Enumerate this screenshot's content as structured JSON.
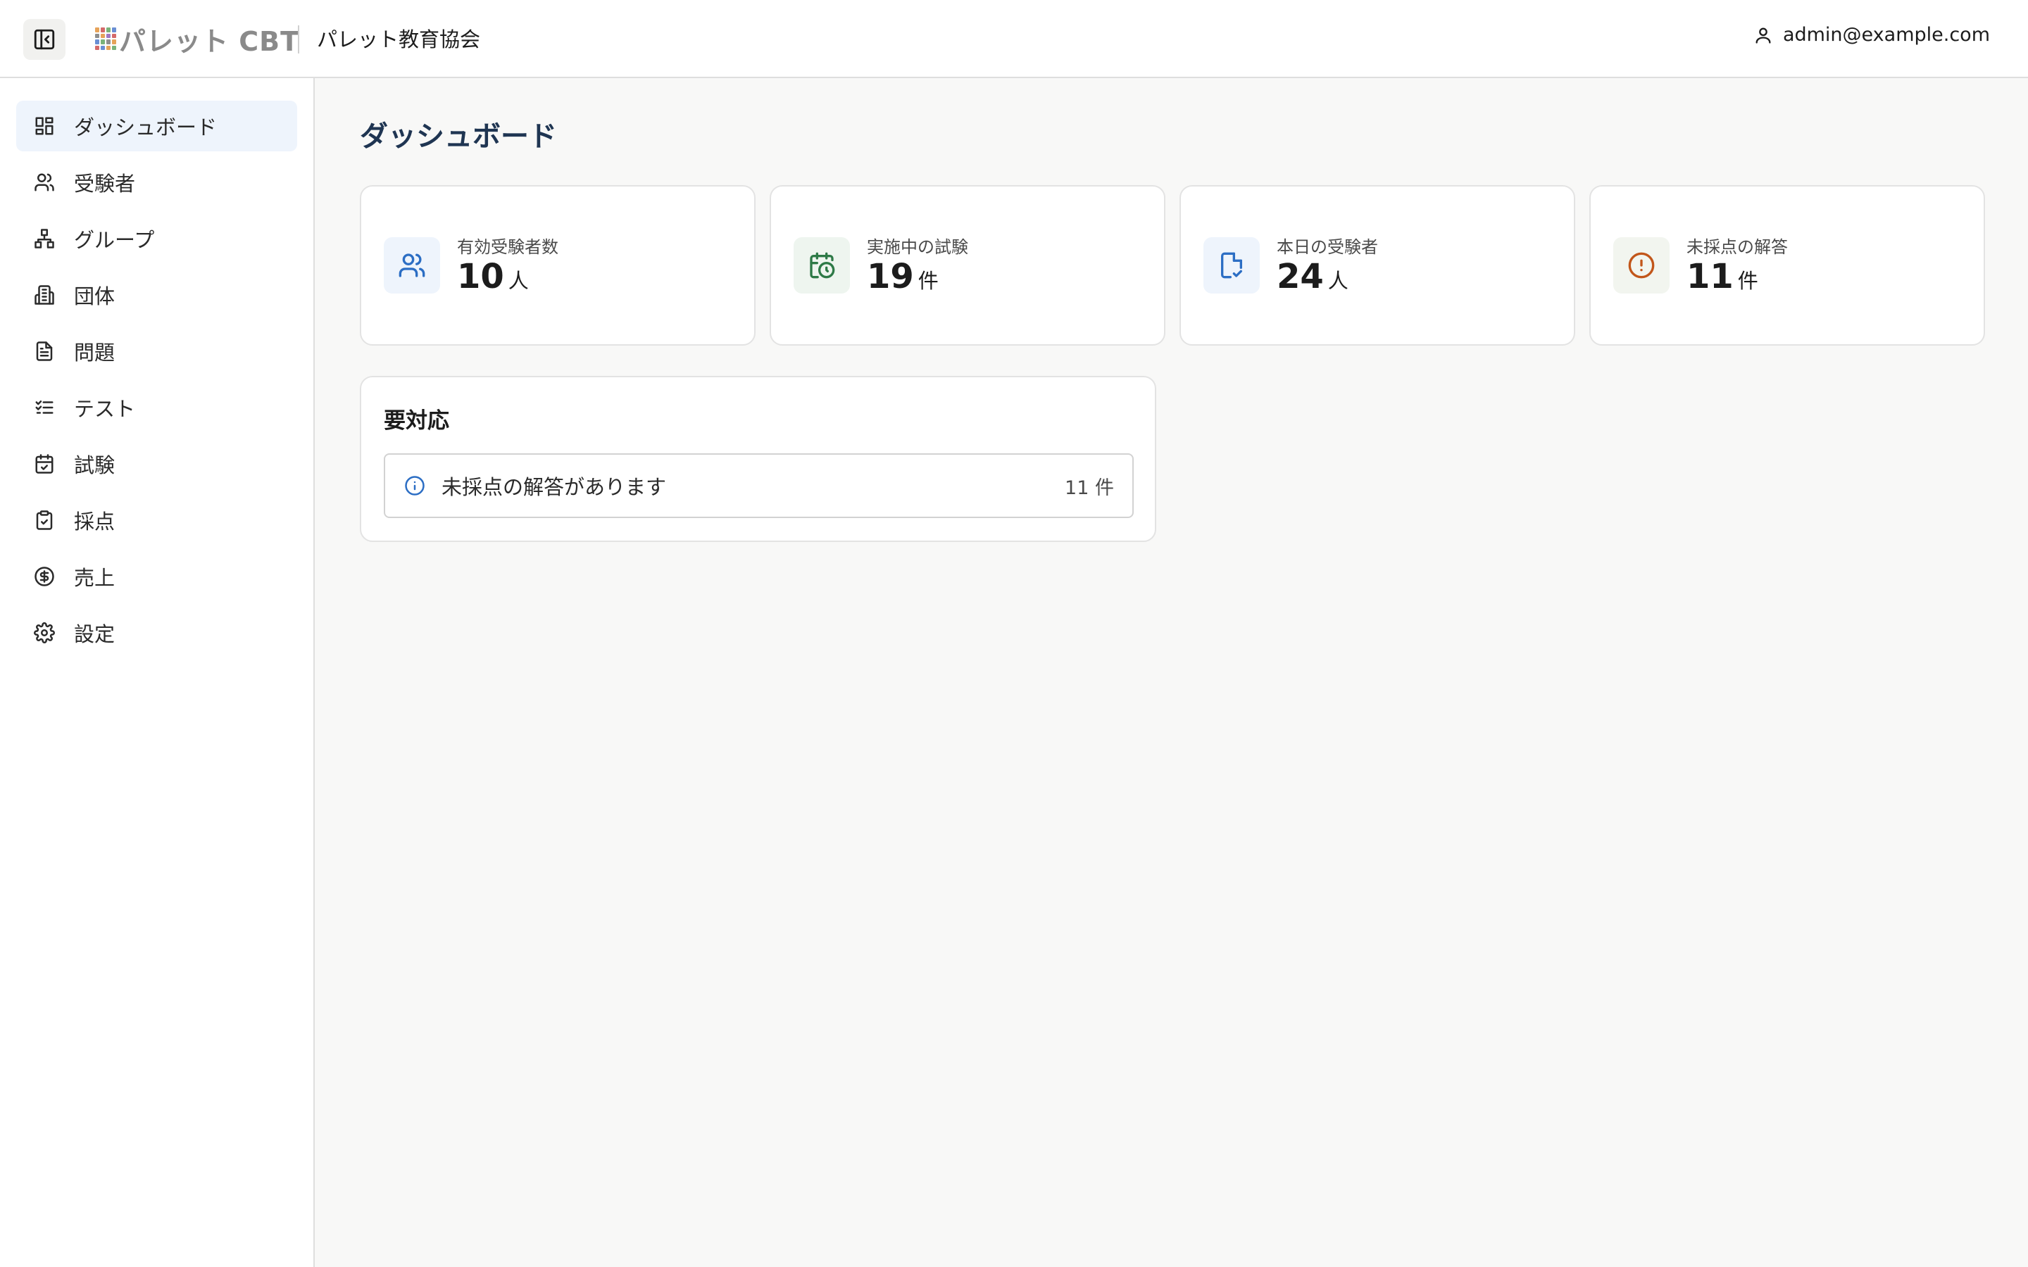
{
  "header": {
    "logo_text": "パレット CBT",
    "org_name": "パレット教育協会",
    "user_email": "admin@example.com"
  },
  "sidebar": {
    "items": [
      {
        "label": "ダッシュボード",
        "icon": "dashboard-icon",
        "active": true
      },
      {
        "label": "受験者",
        "icon": "users-icon"
      },
      {
        "label": "グループ",
        "icon": "network-icon"
      },
      {
        "label": "団体",
        "icon": "building-icon"
      },
      {
        "label": "問題",
        "icon": "document-icon"
      },
      {
        "label": "テスト",
        "icon": "checklist-icon"
      },
      {
        "label": "試験",
        "icon": "calendar-check-icon"
      },
      {
        "label": "採点",
        "icon": "clipboard-check-icon"
      },
      {
        "label": "売上",
        "icon": "dollar-icon"
      },
      {
        "label": "設定",
        "icon": "gear-icon"
      }
    ]
  },
  "main": {
    "title": "ダッシュボード",
    "stats": [
      {
        "label": "有効受験者数",
        "value": "10",
        "unit": "人",
        "icon": "users-icon",
        "color": "#2c6ec4",
        "bg": "#eef4fc"
      },
      {
        "label": "実施中の試験",
        "value": "19",
        "unit": "件",
        "icon": "calendar-clock-icon",
        "color": "#2e7a47",
        "bg": "#eef5ef"
      },
      {
        "label": "本日の受験者",
        "value": "24",
        "unit": "人",
        "icon": "file-check-icon",
        "color": "#2c6ec4",
        "bg": "#eef4fc"
      },
      {
        "label": "未採点の解答",
        "value": "11",
        "unit": "件",
        "icon": "alert-circle-icon",
        "color": "#c2561a",
        "bg": "#f2f5ef"
      }
    ],
    "action": {
      "title": "要対応",
      "row_text": "未採点の解答があります",
      "row_count": "11 件"
    }
  }
}
